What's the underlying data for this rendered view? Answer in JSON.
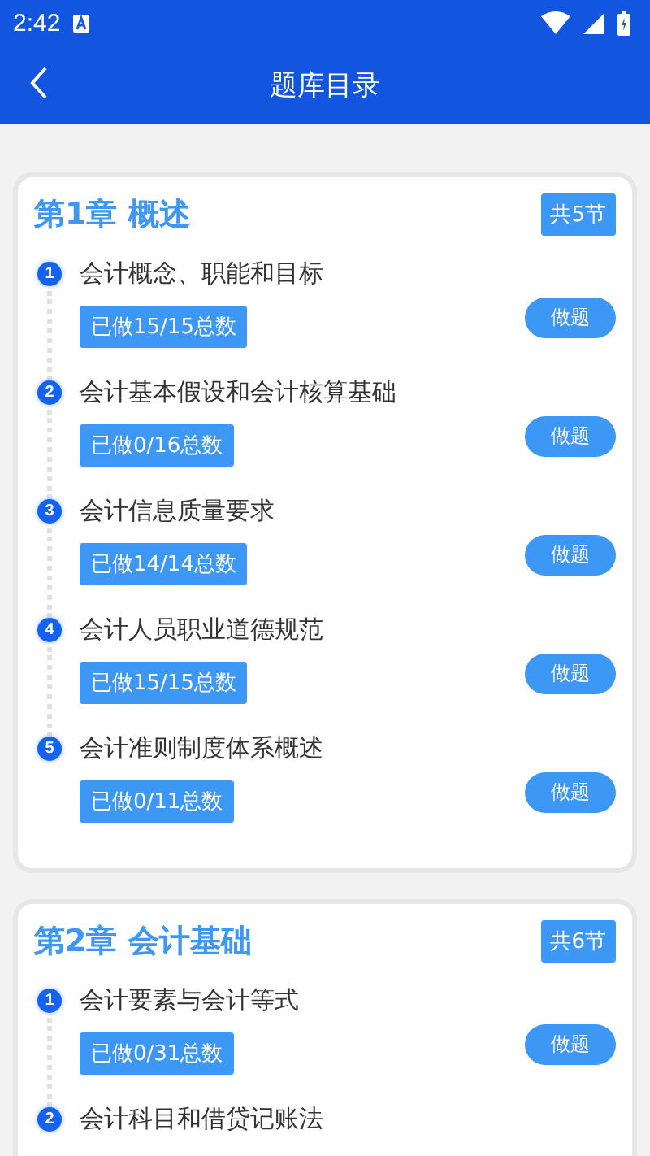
{
  "status_bar": {
    "time": "2:42"
  },
  "header": {
    "title": "题库目录"
  },
  "chapters": [
    {
      "title": "第1章 概述",
      "count": "共5节",
      "sections": [
        {
          "number": "1",
          "title": "会计概念、职能和目标",
          "progress": "已做15/15总数",
          "action": "做题"
        },
        {
          "number": "2",
          "title": "会计基本假设和会计核算基础",
          "progress": "已做0/16总数",
          "action": "做题"
        },
        {
          "number": "3",
          "title": "会计信息质量要求",
          "progress": "已做14/14总数",
          "action": "做题"
        },
        {
          "number": "4",
          "title": "会计人员职业道德规范",
          "progress": "已做15/15总数",
          "action": "做题"
        },
        {
          "number": "5",
          "title": "会计准则制度体系概述",
          "progress": "已做0/11总数",
          "action": "做题"
        }
      ]
    },
    {
      "title": "第2章 会计基础",
      "count": "共6节",
      "sections": [
        {
          "number": "1",
          "title": "会计要素与会计等式",
          "progress": "已做0/31总数",
          "action": "做题"
        },
        {
          "number": "2",
          "title": "会计科目和借贷记账法"
        }
      ]
    }
  ]
}
